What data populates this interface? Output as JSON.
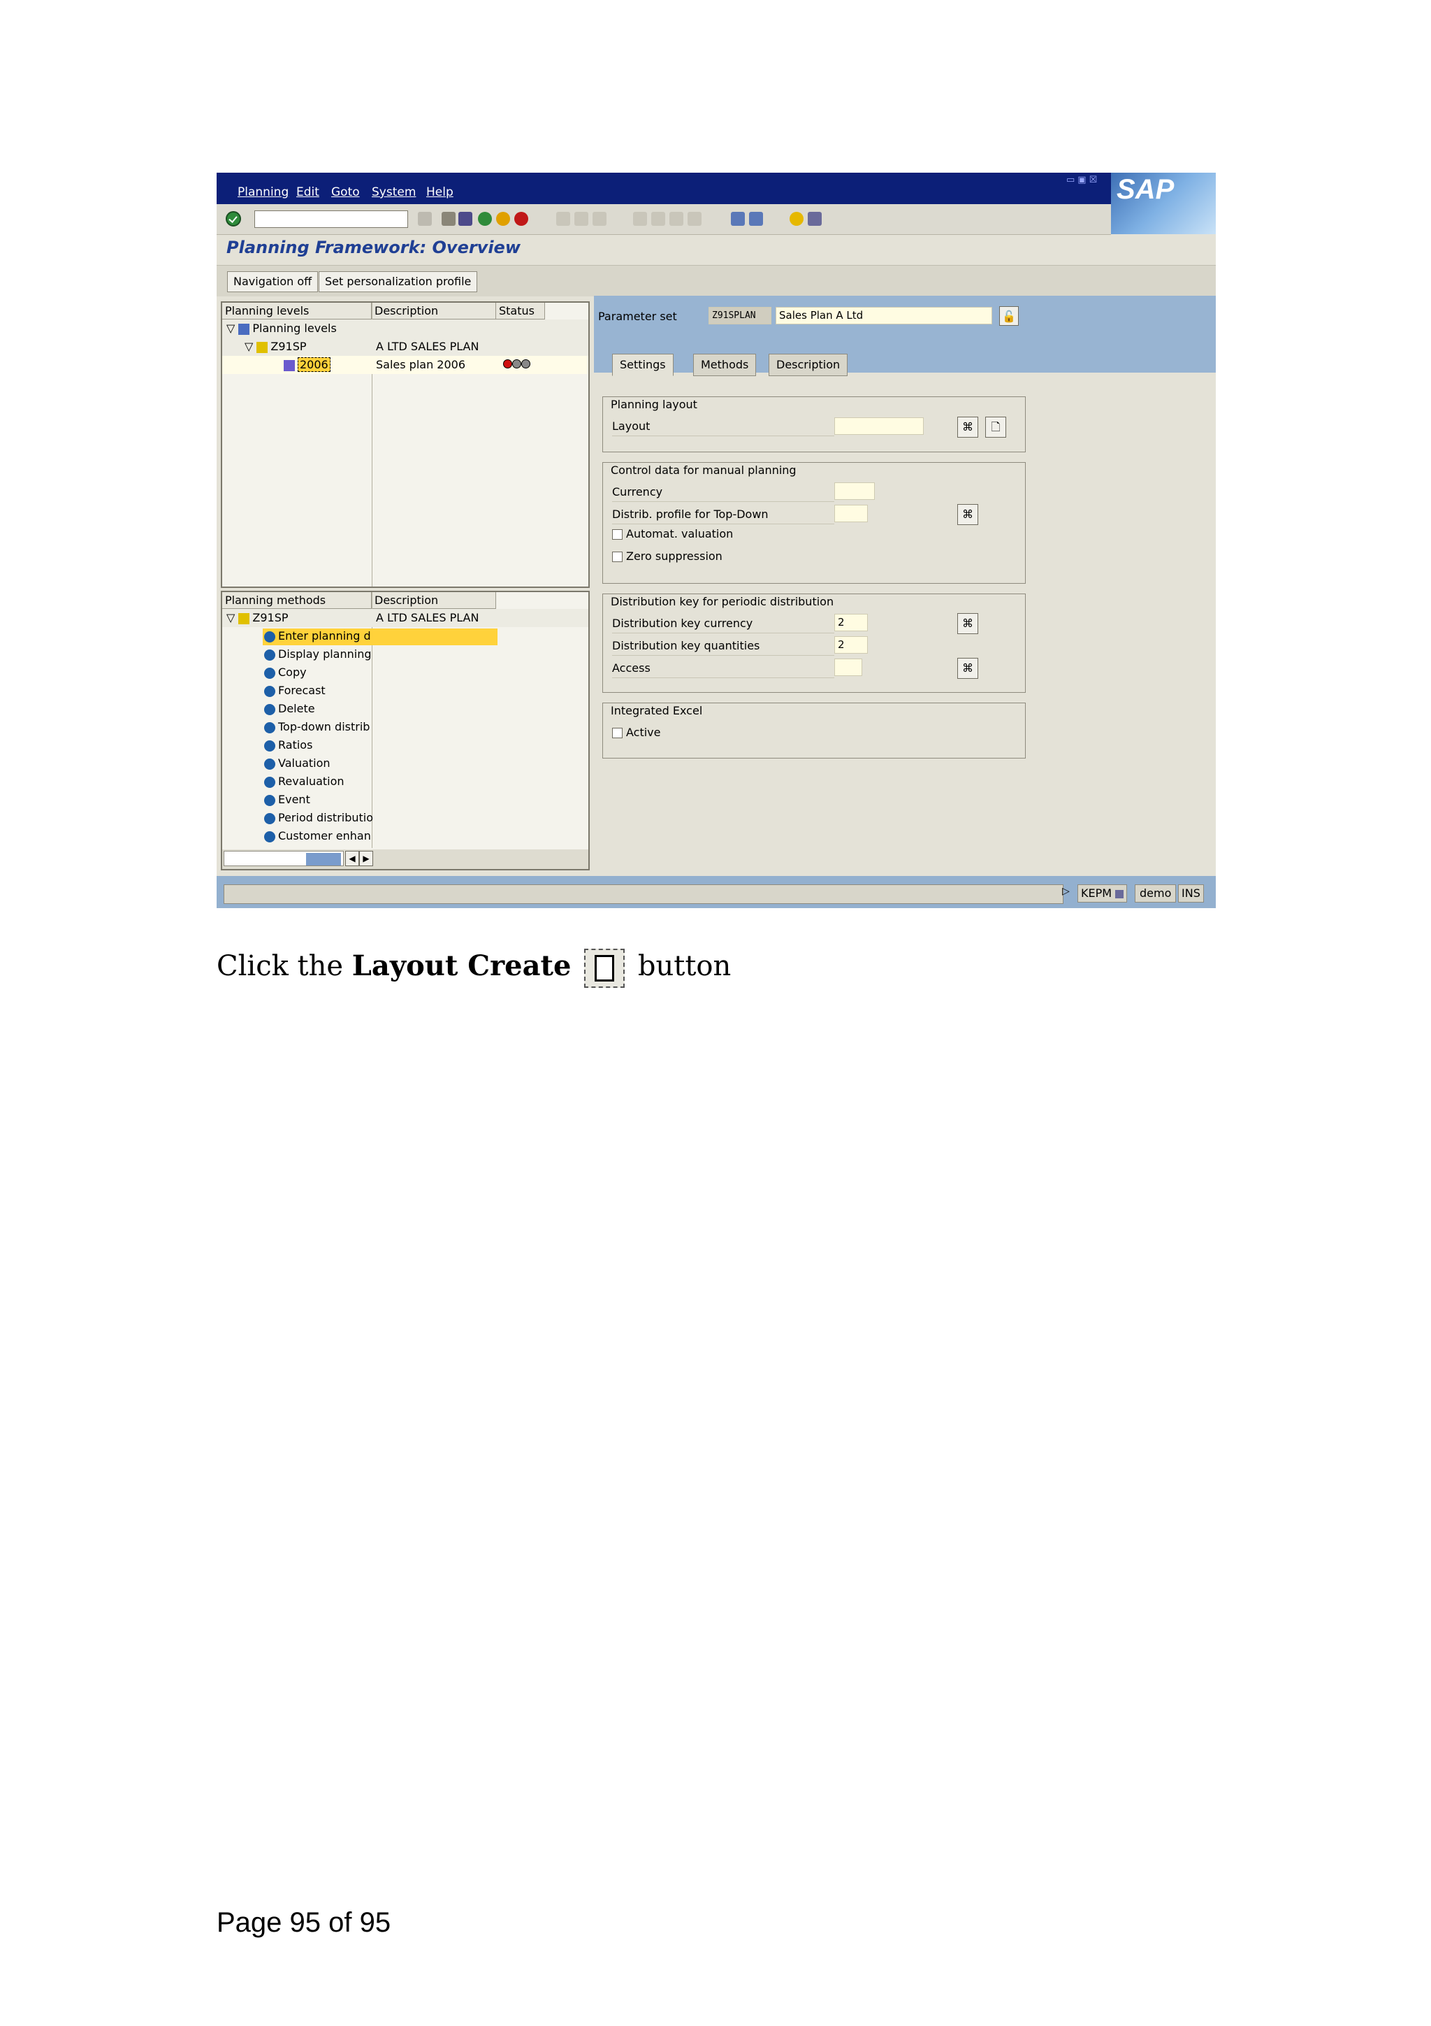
{
  "window": {
    "menu": [
      "Planning",
      "Edit",
      "Goto",
      "System",
      "Help"
    ],
    "logo": "SAP",
    "title": "Planning Framework: Overview",
    "app_buttons": [
      "Navigation off",
      "Set personalization profile"
    ]
  },
  "planning_levels": {
    "headers": [
      "Planning levels",
      "Description",
      "Status"
    ],
    "rows": [
      {
        "name": "Planning levels",
        "desc": "",
        "status": ""
      },
      {
        "name": "Z91SP",
        "desc": "A LTD SALES PLAN",
        "status": ""
      },
      {
        "name": "2006",
        "desc": "Sales plan 2006",
        "status": "red-yellow-green-lights"
      }
    ]
  },
  "planning_methods": {
    "headers": [
      "Planning methods",
      "Description"
    ],
    "root": {
      "name": "Z91SP",
      "desc": "A LTD SALES PLAN"
    },
    "items": [
      "Enter planning d",
      "Display planning",
      "Copy",
      "Forecast",
      "Delete",
      "Top-down distrib",
      "Ratios",
      "Valuation",
      "Revaluation",
      "Event",
      "Period distributio",
      "Customer enhan"
    ]
  },
  "param": {
    "label": "Parameter set",
    "code": "Z91SPLAN",
    "value": "Sales Plan A Ltd"
  },
  "tabs": [
    "Settings",
    "Methods",
    "Description"
  ],
  "groups": {
    "layout": {
      "title": "Planning layout",
      "field": "Layout",
      "value": ""
    },
    "control": {
      "title": "Control data for manual planning",
      "currency": "Currency",
      "distrib": "Distrib. profile for Top-Down",
      "automat": "Automat. valuation",
      "zero": "Zero suppression"
    },
    "distkey": {
      "title": "Distribution key for periodic distribution",
      "currency_label": "Distribution key currency",
      "currency_value": "2",
      "quantities_label": "Distribution key quantities",
      "quantities_value": "2",
      "access_label": "Access"
    },
    "excel": {
      "title": "Integrated Excel",
      "active": "Active"
    }
  },
  "status": {
    "system": "KEPM",
    "client": "demo",
    "mode": "INS"
  },
  "caption": {
    "pre": "Click the ",
    "bold": "Layout Create",
    "post": " button"
  },
  "footer": "Page 95 of 95",
  "colors": {
    "menubar": "#0c1f78",
    "panel_blue": "#98b4d2",
    "highlight": "#ffd23b",
    "title": "#1f3f94"
  }
}
